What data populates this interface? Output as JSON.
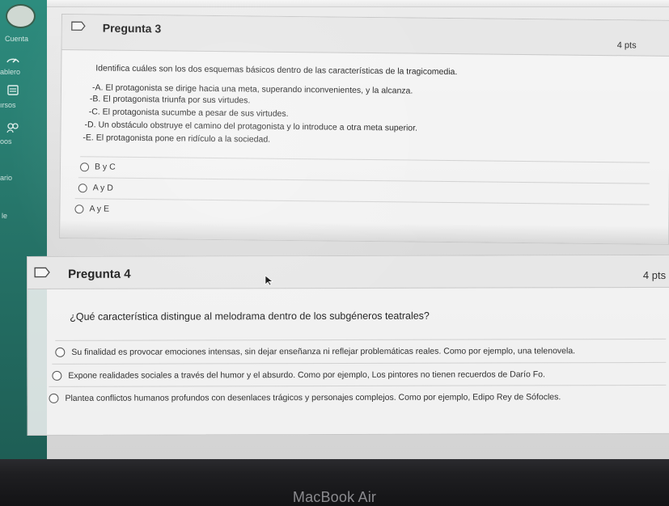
{
  "sidebar": {
    "items": [
      {
        "label": "Cuenta",
        "icon": "account-circle-icon"
      },
      {
        "label": "ablero",
        "icon": "dashboard-icon"
      },
      {
        "label": "ırsos",
        "icon": "courses-icon"
      },
      {
        "label": "oos",
        "icon": "groups-icon"
      },
      {
        "label": "ario",
        "icon": "calendar-icon"
      },
      {
        "label": "le",
        "icon": "inbox-icon"
      }
    ]
  },
  "questions": [
    {
      "title": "Pregunta 3",
      "points": "4 pts",
      "prompt": "Identifica cuáles son los dos esquemas básicos dentro de las características de la tragicomedia.",
      "statements": [
        "-A. El protagonista se dirige hacia una meta, superando inconvenientes, y la alcanza.",
        "-B. El protagonista triunfa por sus virtudes.",
        "-C. El protagonista sucumbe a pesar de sus virtudes.",
        "-D. Un obstáculo obstruye el camino del protagonista y lo introduce a otra meta superior.",
        "-E. El protagonista pone en ridículo a la sociedad."
      ],
      "answers": [
        "B y C",
        "A y D",
        "A y E"
      ]
    },
    {
      "title": "Pregunta 4",
      "points": "4 pts",
      "prompt": "¿Qué característica distingue al melodrama dentro de los subgéneros teatrales?",
      "answers": [
        "Su finalidad es provocar emociones intensas, sin dejar enseñanza ni reflejar problemáticas reales. Como por ejemplo, una telenovela.",
        "Expone realidades sociales a través del humor y el absurdo. Como por ejemplo, Los pintores no tienen recuerdos de Darío Fo.",
        "Plantea conflictos humanos profundos con desenlaces trágicos y personajes complejos. Como por ejemplo, Edipo Rey de Sófocles."
      ]
    }
  ],
  "device": {
    "brand": "MacBook Air"
  },
  "colors": {
    "sidebar": "#246f64",
    "text": "#252525",
    "card": "#f6f6f6",
    "bezel": "#1f1f22"
  }
}
